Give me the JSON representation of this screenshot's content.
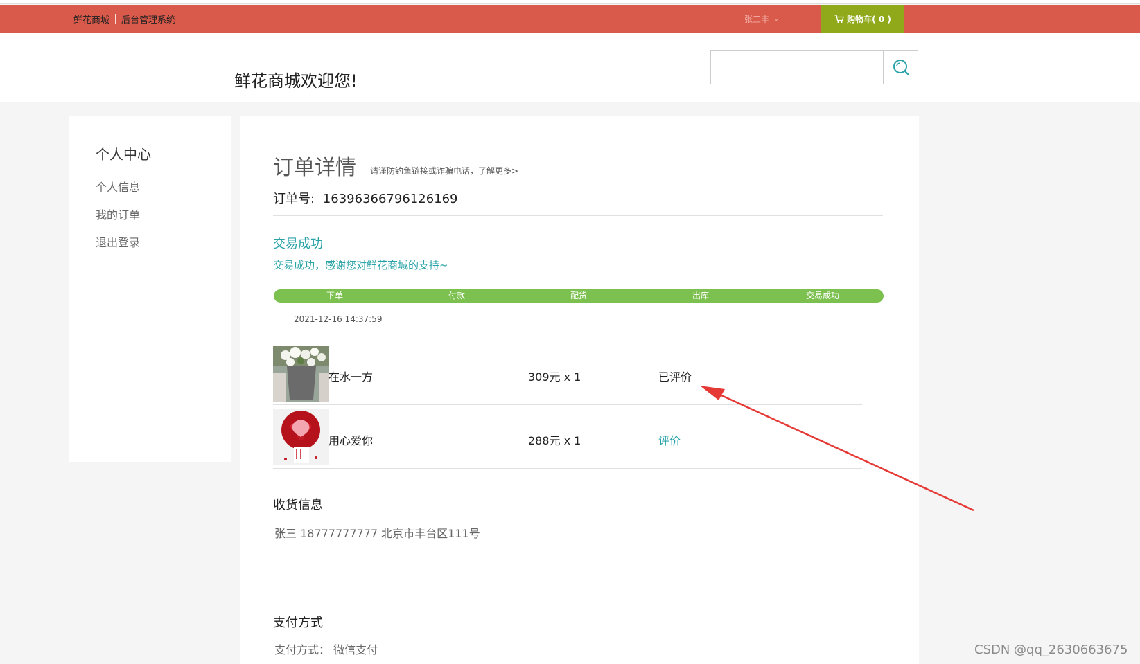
{
  "topbar": {
    "shop_link": "鲜花商城",
    "admin_link": "后台管理系统",
    "username": "张三丰",
    "cart_label": "购物车( 0 )"
  },
  "header": {
    "welcome": "鲜花商城欢迎您!",
    "search_placeholder": ""
  },
  "sidebar": {
    "title": "个人中心",
    "items": [
      {
        "label": "个人信息"
      },
      {
        "label": "我的订单"
      },
      {
        "label": "退出登录"
      }
    ]
  },
  "order": {
    "title": "订单详情",
    "tip": "请谨防钓鱼链接或诈骗电话，了解更多>",
    "number_label": "订单号:",
    "number": "16396366796126169",
    "status": "交易成功",
    "thanks": "交易成功，感谢您对鲜花商城的支持~",
    "steps": [
      "下单",
      "付款",
      "配货",
      "出库",
      "交易成功"
    ],
    "date": "2021-12-16 14:37:59",
    "items": [
      {
        "name": "在水一方",
        "price": "309元 x 1",
        "action": "已评价"
      },
      {
        "name": "用心爱你",
        "price": "288元 x 1",
        "action": "评价"
      }
    ],
    "shipping": {
      "title": "收货信息",
      "text": "张三 18777777777 北京市丰台区111号"
    },
    "payment": {
      "title": "支付方式",
      "text": "支付方式：  微信支付"
    }
  },
  "watermark": "CSDN @qq_2630663675",
  "colors": {
    "topbar": "#d9594a",
    "cart": "#8fa91b",
    "accent": "#2aa3a8",
    "progress": "#7cc04f",
    "arrow": "#e53935"
  }
}
